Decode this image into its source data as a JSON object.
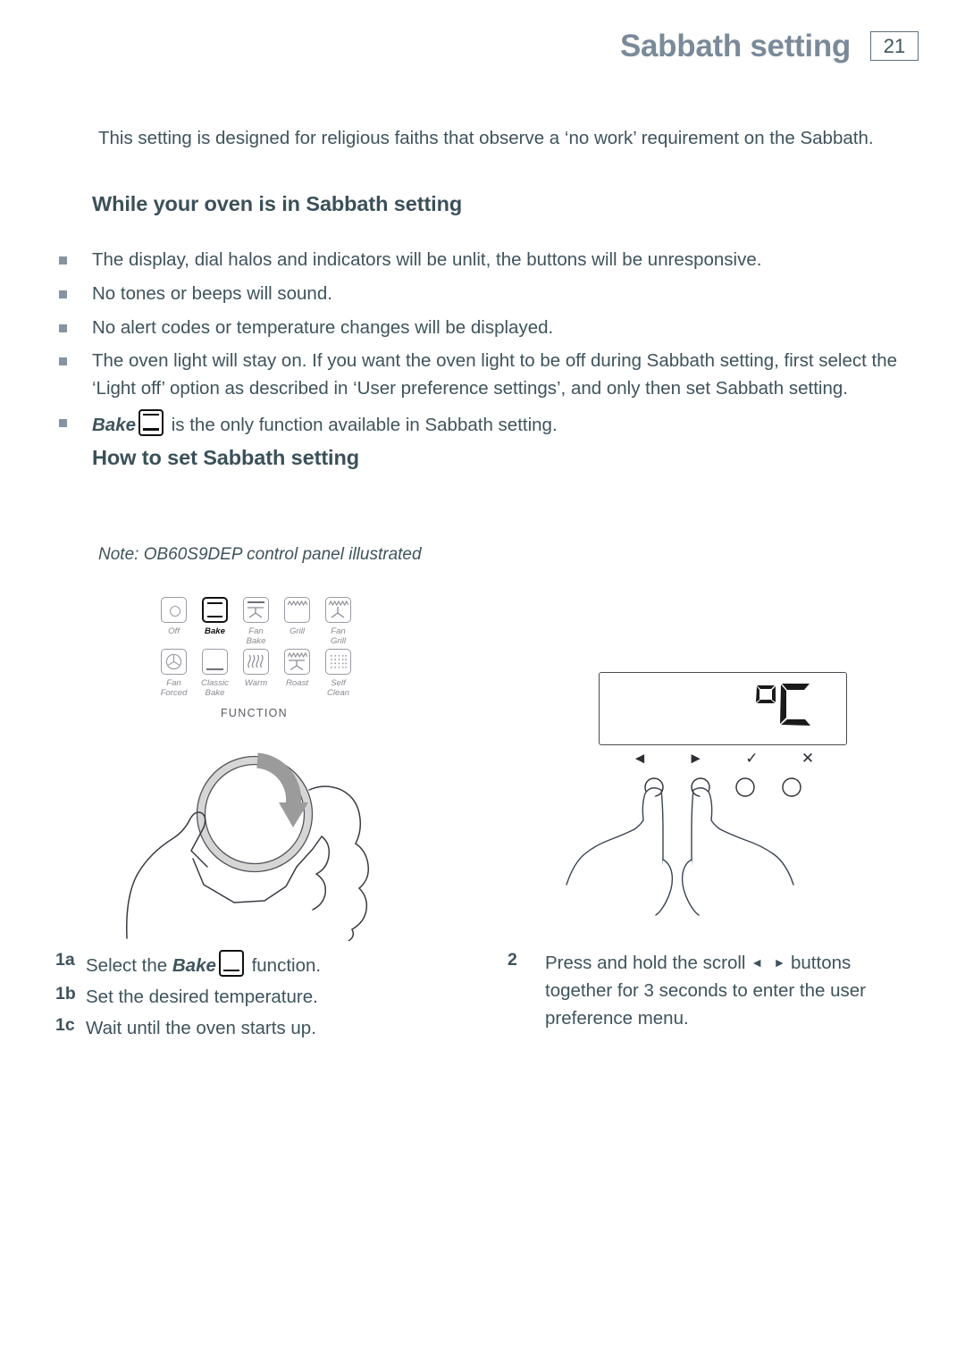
{
  "header": {
    "title": "Sabbath setting",
    "page_number": "21"
  },
  "intro": "This setting is designed for religious faiths that observe a ‘no work’ requirement on the Sabbath.",
  "headings": {
    "while": "While your oven is in Sabbath setting",
    "how_to": "How to set Sabbath setting"
  },
  "bullets": [
    {
      "text": "The display, dial halos and indicators will be unlit, the buttons will be unresponsive."
    },
    {
      "text": "No tones or beeps will sound."
    },
    {
      "text": "No alert codes or temperature changes will be displayed."
    },
    {
      "text": "The oven light will stay on. If you want the oven light to be off during Sabbath setting, first select the ‘Light off’ option as described in ‘User preference settings’, and only then set Sabbath setting."
    },
    {
      "emphasis": "Bake",
      "icon": "bake-function-icon",
      "text": "is the only function available in Sabbath setting."
    }
  ],
  "note": "Note: OB60S9DEP control panel illustrated",
  "control_panel": {
    "caption": "FUNCTION",
    "functions": [
      {
        "label": "Off",
        "label_line1": "Off",
        "label_line2": "",
        "icon": "oven-off-icon",
        "selected": false
      },
      {
        "label": "Bake",
        "label_line1": "Bake",
        "label_line2": "",
        "icon": "bake-icon",
        "selected": true
      },
      {
        "label": "Fan Bake",
        "label_line1": "Fan",
        "label_line2": "Bake",
        "icon": "fan-bake-icon",
        "selected": false
      },
      {
        "label": "Grill",
        "label_line1": "Grill",
        "label_line2": "",
        "icon": "grill-icon",
        "selected": false
      },
      {
        "label": "Fan Grill",
        "label_line1": "Fan",
        "label_line2": "Grill",
        "icon": "fan-grill-icon",
        "selected": false
      },
      {
        "label": "Fan Forced",
        "label_line1": "Fan",
        "label_line2": "Forced",
        "icon": "fan-forced-icon",
        "selected": false
      },
      {
        "label": "Classic Bake",
        "label_line1": "Classic",
        "label_line2": "Bake",
        "icon": "classic-bake-icon",
        "selected": false
      },
      {
        "label": "Warm",
        "label_line1": "Warm",
        "label_line2": "",
        "icon": "warm-icon",
        "selected": false
      },
      {
        "label": "Roast",
        "label_line1": "Roast",
        "label_line2": "",
        "icon": "roast-icon",
        "selected": false
      },
      {
        "label": "Self Clean",
        "label_line1": "Self",
        "label_line2": "Clean",
        "icon": "self-clean-icon",
        "selected": false
      }
    ]
  },
  "display": {
    "readout": "°C",
    "buttons": [
      {
        "name": "scroll-left-button",
        "glyph": "◄",
        "pressed": true
      },
      {
        "name": "scroll-right-button",
        "glyph": "►",
        "pressed": true
      },
      {
        "name": "confirm-button",
        "glyph": "✓",
        "pressed": false
      },
      {
        "name": "cancel-button",
        "glyph": "✕",
        "pressed": false
      }
    ]
  },
  "steps_left": [
    {
      "num": "1a",
      "pre": "Select the ",
      "emphasis": "Bake",
      "post": " function."
    },
    {
      "num": "1b",
      "text": "Set the desired temperature."
    },
    {
      "num": "1c",
      "text": "Wait until the oven starts up."
    }
  ],
  "steps_right": [
    {
      "num": "2",
      "pre": "Press and hold the scroll ",
      "post": " buttons together for 3 seconds to enter the user preference menu."
    }
  ],
  "colors": {
    "body_text": "#3f535c",
    "header_title": "#7b8a99",
    "bullet_marker": "#8793a0",
    "icon_outline": "#9a9aa3",
    "selected_outline": "#111111",
    "knob_arrow": "#9b9b9b"
  }
}
